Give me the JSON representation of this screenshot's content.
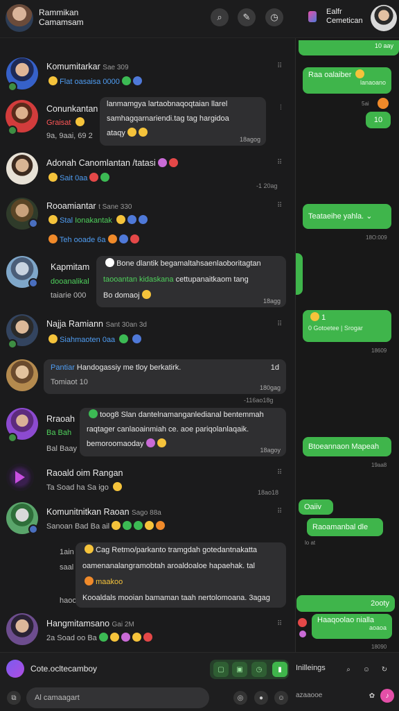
{
  "header": {
    "title": "Rammikan",
    "subtitle": "Camamsam"
  },
  "chats": [
    {
      "name": "Komumitarkar",
      "name_meta": "Sae 309",
      "sub": "Flat oasaisa 0000",
      "time": ""
    },
    {
      "name": "Conunkantan",
      "sub_a": "Graisat",
      "sub_b": "9a, 9aai, 69",
      "sub_c": "2",
      "bubble": [
        "lanmamgya lartaobnaqoqtaian llarel",
        "samhagqarnariendi.tag tag hargidoa",
        "ataqy"
      ],
      "bubble_time": "18agog"
    },
    {
      "name": "Adonah Canomlantan /tatasi",
      "sub": "Sait 0aa",
      "time": "-1 20ag"
    },
    {
      "name": "Rooamiantar",
      "name_meta": "t Sane 330",
      "sub_a": "Stal",
      "sub_b": "Ionakantak",
      "sub2": "Teh ooade 6a"
    },
    {
      "name": "Kapmitam",
      "sub_a": "dooanalikal",
      "sub_b": "taiarie 000",
      "bubble": [
        "Bone dlantik begamaltahsaenlaoboritagtan",
        "taooantan kidaskana",
        "cettupanaitkaom tang",
        "Bo domaoj"
      ],
      "bubble_time": "18agg"
    },
    {
      "name": "Najja Ramiann",
      "name_meta": "Sant 30an 3d",
      "sub": "Siahmaoten 0aa",
      "time": ""
    },
    {
      "name": "",
      "bubble_head": "Pantiar",
      "bubble_text": "Handogassiy me tloy berkatirk.",
      "bubble_sub": "Tomiaot 10",
      "bubble_time": "180gag",
      "bubble_tag": "1d",
      "time": "-116ao18g"
    },
    {
      "name": "Rraoah",
      "sub_a": "Ba Bah",
      "sub_b": "Bal Baay",
      "bubble": [
        "toog8 Slan dantelnamanganledianal bentemmah",
        "raqtager canlaoainmiah ce. aoe pariqolanlaqaik.",
        "bemoroomaoday"
      ],
      "bubble_time": "18agoy"
    },
    {
      "name": "Raoald oim Rangan",
      "sub": "Ta Soad ha Sa igo",
      "time": "18ao18"
    },
    {
      "name": "Komunitnitkan Raoan",
      "name_meta": "Sago 88a",
      "sub": "Sanoan Bad Ba ail",
      "time": ""
    },
    {
      "name": "",
      "sub_a": "1ain",
      "sub_b": "saal",
      "sub_c": "haoo",
      "bubble": [
        "Cag Retmo/parkanto tramgdah gotedantnakatta",
        "oamenanalangramobtah aroaldoaloe hapaehak. tal",
        "maakoo",
        "Kooaldals mooian bamaman taah nertolomoana. 3agag"
      ],
      "bubble_time": ""
    },
    {
      "name": "Hangmitamsano",
      "name_meta": "Gai 2M",
      "sub": "2a Soad oo Ba",
      "time": ""
    }
  ],
  "composer": {
    "top_label": "Cote.ocltecamboy",
    "placeholder": "Al camaagart"
  },
  "right_panel": {
    "title": "Ealfr",
    "subtitle": "Cemetican",
    "time_top": "10 aay",
    "msgs": [
      {
        "text": "Raa oalaiber",
        "sub": "lanaoano",
        "time": ""
      },
      {
        "text": "10",
        "time": "5ai"
      },
      {
        "text": "Teataeihe yahla.",
        "time": "18O:009"
      },
      {
        "text": "1",
        "sub": "0 Gotoetee",
        "sub2": "Srogar",
        "time": "18609"
      },
      {
        "text": "Btoeannaon Mapeah",
        "time": "19aa8"
      },
      {
        "text": "Oaiiv",
        "time": ""
      },
      {
        "text": "Raoamanbal dle",
        "time": "lo at"
      },
      {
        "text": "2ooty",
        "time": ""
      },
      {
        "text": "Haaqoolao nialla",
        "sub": "aoaoa",
        "time": "18090"
      }
    ],
    "input_label": "Inilleings",
    "input_placeholder": "azaaooe"
  },
  "colors": {
    "accent_green": "#3fb54b",
    "panel_bg": "#1b1b1c",
    "bubble_bg": "#2f2f31"
  }
}
